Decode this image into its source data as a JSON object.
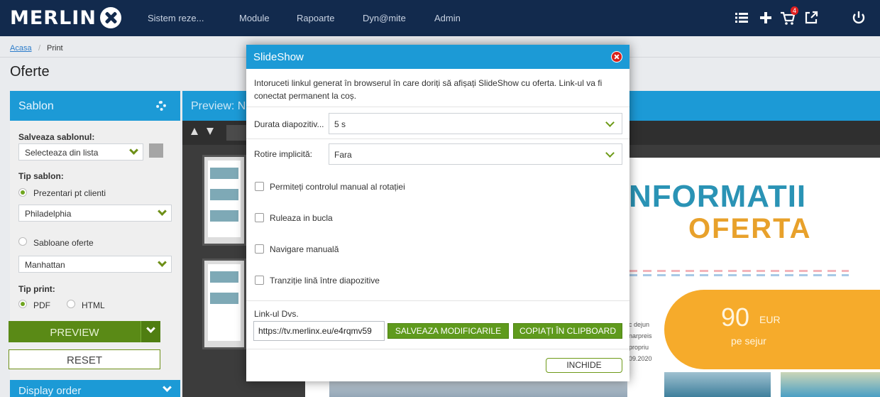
{
  "logo": {
    "text": "MERLIN"
  },
  "nav": {
    "items": [
      "Sistem reze...",
      "Module",
      "Rapoarte",
      "Dyn@mite",
      "Admin"
    ],
    "cart_count": "4"
  },
  "breadcrumb": {
    "home": "Acasa",
    "separator": "/",
    "current": "Print"
  },
  "page": {
    "title": "Oferte"
  },
  "sidebar": {
    "title": "Sablon",
    "save_label": "Salveaza sablonul:",
    "save_select": "Selecteaza din lista",
    "type_label": "Tip sablon:",
    "radio_presentations": "Prezentari pt clienti",
    "presentation_select": "Philadelphia",
    "radio_templates": "Sabloane oferte",
    "template_select": "Manhattan",
    "print_label": "Tip print:",
    "radio_pdf": "PDF",
    "radio_html": "HTML",
    "preview_button": "PREVIEW",
    "reset_button": "RESET",
    "display_order": "Display order"
  },
  "preview": {
    "title": "Preview: N"
  },
  "slide": {
    "heading1": "NFORMATII",
    "heading2": "OFERTA",
    "price": "90",
    "price_unit": "EUR",
    "price_sub": "pe sejur",
    "text_lines": [
      "c dejun",
      "narpreis",
      "propriu",
      "09.2020"
    ]
  },
  "modal": {
    "title": "SlideShow",
    "intro": "Intoruceti linkul generat în browserul în care doriți să afișați SlideShow cu oferta. Link-ul va fi conectat permanent la coș.",
    "duration_label": "Durata diapozitiv...",
    "duration_value": "5 s",
    "rotation_label": "Rotire implicită:",
    "rotation_value": "Fara",
    "checkbox_manual_rotation": "Permiteți controlul manual al rotației",
    "checkbox_loop": "Ruleaza in bucla",
    "checkbox_manual_nav": "Navigare manuală",
    "checkbox_transition": "Tranziție lină între diapozitive",
    "link_label": "Link-ul Dvs.",
    "link_value": "https://tv.merlinx.eu/e4rqmv59",
    "save_button": "SALVEAZA MODIFICARILE",
    "copy_button": "COPIAȚI ÎN CLIPBOARD",
    "close_button": "INCHIDE"
  },
  "colors": {
    "navbar": "#122a4d",
    "accent_blue": "#1c9ad6",
    "accent_green": "#5f9a1d",
    "close_red": "#d9221c",
    "slide_orange": "#f6ab2b"
  }
}
